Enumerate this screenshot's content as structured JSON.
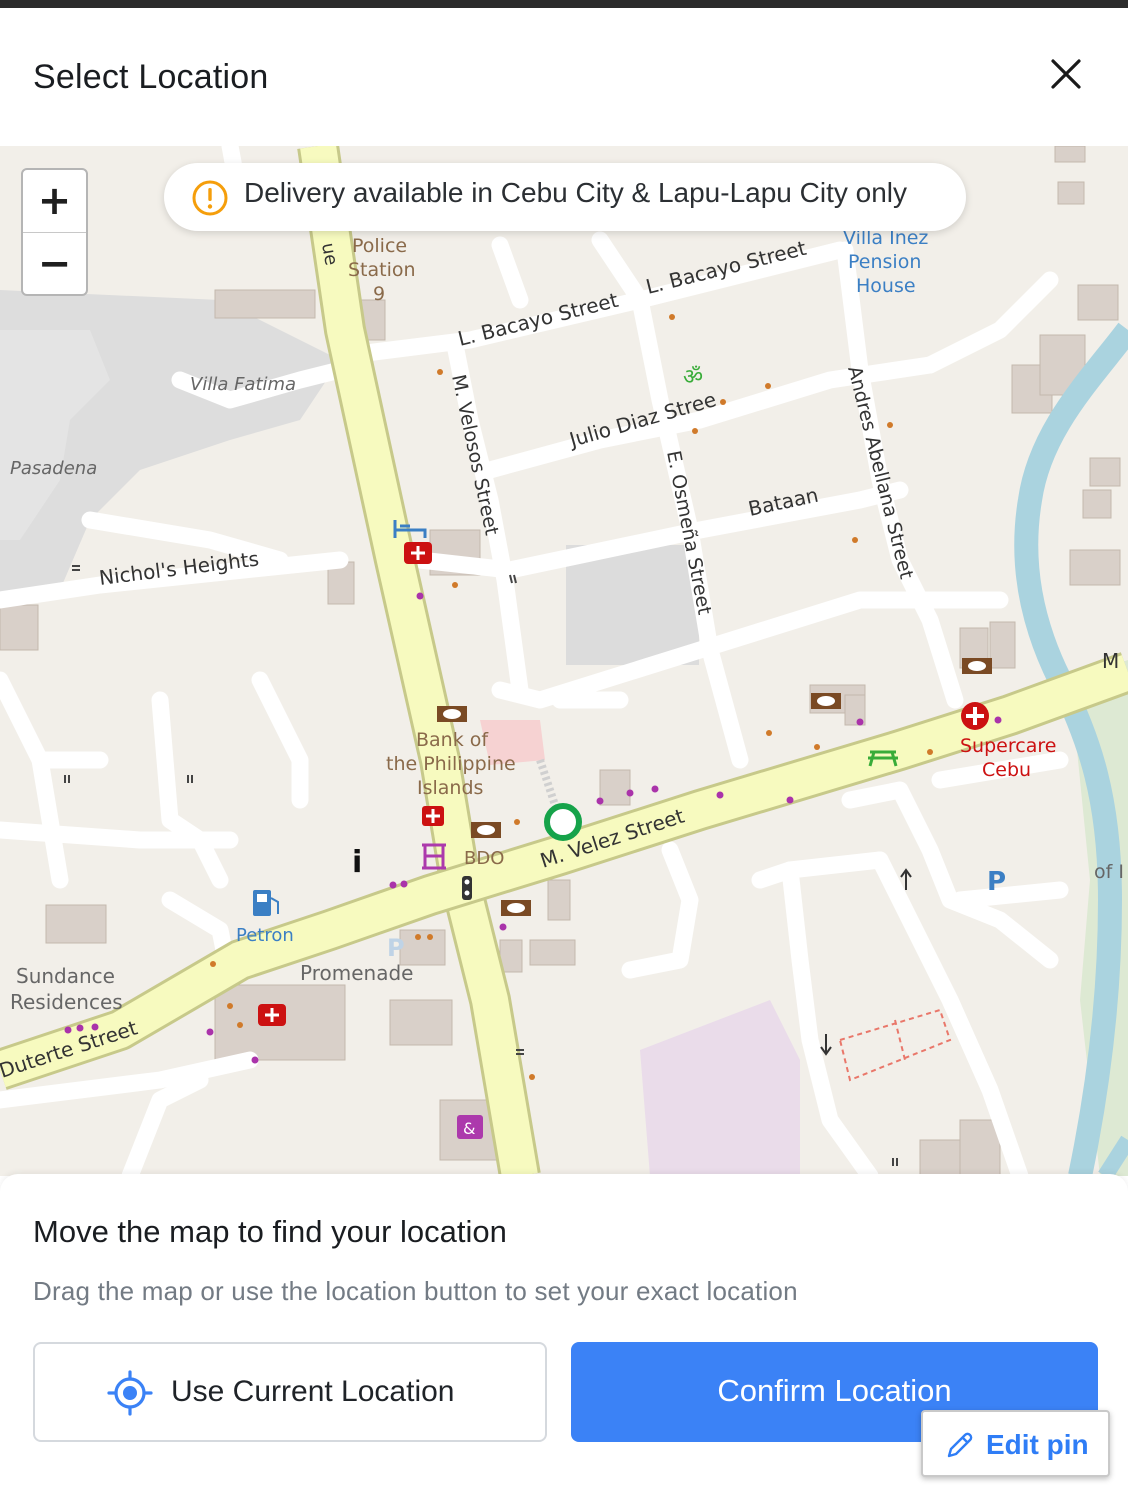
{
  "dialog": {
    "title": "Select Location"
  },
  "notice": {
    "text": "Delivery available in Cebu City & Lapu-Lapu City only"
  },
  "zoom": {
    "in_label": "+",
    "out_label": "−"
  },
  "map": {
    "labels": {
      "police_station": [
        "Police",
        "Station",
        "9"
      ],
      "villa_inez": [
        "Villa Inez",
        "Pension",
        "House"
      ],
      "villa_fatima": "Villa Fatima",
      "pasadena": "Pasadena",
      "nichols_heights": "Nichol's Heights",
      "l_bacayo_street_1": "L. Bacayo Street",
      "l_bacayo_street_2": "L. Bacayo Street",
      "m_velosos_street": "M. Velosos Street",
      "julio_diaz_street": "Julio Diaz Stree",
      "e_osmena_street": "E. Osmeña Street",
      "bataan": "Bataan",
      "andres_abellana_street": "Andres Abellana Street",
      "bank_of_pi": [
        "Bank of",
        "the Philippine",
        "Islands"
      ],
      "bdo": "BDO",
      "m_velez_street": "M. Velez Street",
      "supercare_cebu": [
        "Supercare",
        "Cebu"
      ],
      "petron": "Petron",
      "promenade": "Promenade",
      "sundance_residences": [
        "Sundance",
        "Residences"
      ],
      "duterte_street": "Duterte Street",
      "avenue_partial": "ue",
      "edge_m": "M",
      "edge_of": "of I",
      "parking_p": "P"
    },
    "pin_color": "#16a34a"
  },
  "sheet": {
    "heading": "Move the map to find your location",
    "subtext": "Drag the map or use the location button to set your exact location",
    "use_current_label": "Use Current Location",
    "confirm_label": "Confirm Location",
    "edit_pin_label": "Edit pin"
  },
  "colors": {
    "accent": "#3b82f6",
    "edit_pin": "#2f7df6",
    "notice_icon": "#f59e0b",
    "major_road": "#f7fabf",
    "major_road_casing": "#c7c98a"
  }
}
